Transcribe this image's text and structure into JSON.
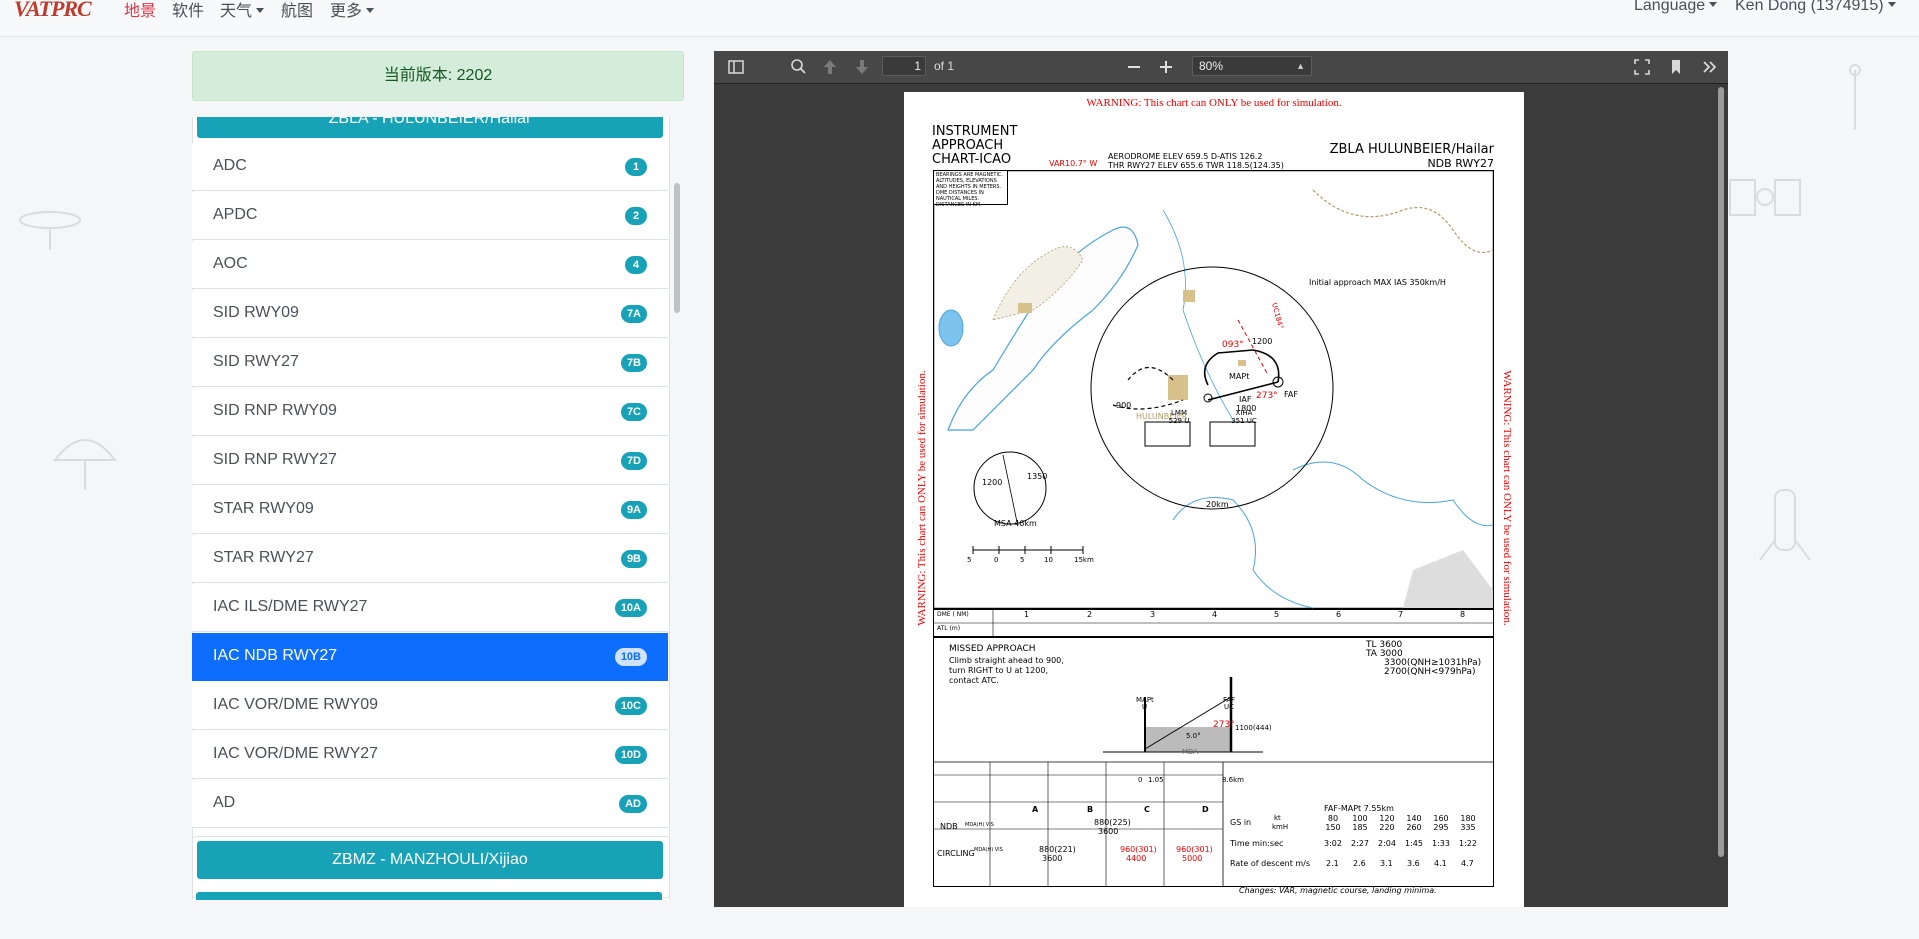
{
  "nav": {
    "brand": "VATPRC",
    "links": [
      "地景",
      "软件",
      "天气",
      "航图",
      "更多"
    ],
    "language": "Language",
    "user": "Ken Dong (1374915)"
  },
  "sidebar": {
    "version": "当前版本: 2202",
    "current_group": "ZBLA - HULUNBEIER/Hailar",
    "items": [
      {
        "label": "ADC",
        "badge": "1"
      },
      {
        "label": "APDC",
        "badge": "2"
      },
      {
        "label": "AOC",
        "badge": "4"
      },
      {
        "label": "SID RWY09",
        "badge": "7A"
      },
      {
        "label": "SID RWY27",
        "badge": "7B"
      },
      {
        "label": "SID RNP RWY09",
        "badge": "7C"
      },
      {
        "label": "SID RNP RWY27",
        "badge": "7D"
      },
      {
        "label": "STAR RWY09",
        "badge": "9A"
      },
      {
        "label": "STAR RWY27",
        "badge": "9B"
      },
      {
        "label": "IAC ILS/DME RWY27",
        "badge": "10A"
      },
      {
        "label": "IAC NDB RWY27",
        "badge": "10B"
      },
      {
        "label": "IAC VOR/DME RWY09",
        "badge": "10C"
      },
      {
        "label": "IAC VOR/DME RWY27",
        "badge": "10D"
      },
      {
        "label": "AD",
        "badge": "AD"
      }
    ],
    "next_group": "ZBMZ - MANZHOULI/Xijiao"
  },
  "viewer": {
    "page_number": "1",
    "page_of": "of 1",
    "zoom": "80%",
    "icons": [
      "sidebar-toggle-icon",
      "search-icon",
      "page-up-icon",
      "page-down-icon",
      "zoom-out-icon",
      "zoom-in-icon",
      "fullscreen-icon",
      "bookmark-icon",
      "tools-icon"
    ]
  },
  "chart": {
    "warning": "WARNING: This chart can ONLY be used for simulation.",
    "title_lines": [
      "INSTRUMENT",
      "APPROACH",
      "CHART-ICAO"
    ],
    "var": "VAR10.7° W",
    "elev": "AERODROME ELEV 659.5   D-ATIS 126.2",
    "thr": "THR RWY27 ELEV 655.6    TWR 118.5(124.35)",
    "airport": "ZBLA HULUNBEIER/Hailar",
    "procedure": "NDB RWY27",
    "bearings_note": [
      "BEARINGS ARE MAGNETIC.",
      "ALTITUDES, ELEVATIONS",
      "AND HEIGHTS IN METERS.",
      "DME DISTANCES IN",
      "NAUTICAL MILES.",
      "DISTANCES IN KM."
    ],
    "initial_approach": "Initial approach MAX IAS 350km/H",
    "city": "HULUNBEIER",
    "lmm": [
      "LMM",
      "529 U"
    ],
    "xiha": [
      "XIHA",
      "351 UC"
    ],
    "fixes": [
      "MAPt",
      "IAF",
      "FAF",
      "1800",
      "1200",
      "900"
    ],
    "courses": [
      "093°",
      "273°",
      "UC184°"
    ],
    "msa": "MSA 46km",
    "msa_alts": [
      "1200",
      "1350"
    ],
    "ring": "20km",
    "scale": [
      "5",
      "0",
      "5",
      "10",
      "15km"
    ],
    "dme_row": [
      "DME (  NM)",
      "1",
      "2",
      "3",
      "4",
      "5",
      "6",
      "7",
      "8"
    ],
    "atl_row": "ATL (m)",
    "missed_title": "MISSED APPROACH",
    "missed_text": [
      "Climb straight ahead to 900,",
      "turn RIGHT to U at 1200,",
      "contact ATC."
    ],
    "tl": [
      "TL 3600",
      "TA 3000",
      "3300(QNH≥1031hPa)",
      "2700(QNH<979hPa)"
    ],
    "profile_labels": [
      "MAPt",
      "U",
      "FAF",
      "UC",
      "273°",
      "5.0°",
      "1100(444)",
      "MDA",
      "0",
      "1.05",
      "8.6km"
    ],
    "minima_header": [
      "A",
      "B",
      "C",
      "D"
    ],
    "ndb_row": [
      "NDB",
      "MDA(H) VIS",
      "880(225)",
      "3600"
    ],
    "circling_row": [
      "CIRCLING",
      "MDA(H) VIS",
      "880(221)",
      "3600",
      "960(301)",
      "4400",
      "960(301)",
      "5000"
    ],
    "faf_table_title": "FAF-MAPt 7.55km",
    "gs_label": [
      "GS in",
      "kt",
      "kmH"
    ],
    "gs_values": [
      [
        "80",
        "150"
      ],
      [
        "100",
        "185"
      ],
      [
        "120",
        "220"
      ],
      [
        "140",
        "260"
      ],
      [
        "160",
        "295"
      ],
      [
        "180",
        "335"
      ]
    ],
    "time_label": "Time   min:sec",
    "time_values": [
      "3:02",
      "2:27",
      "2:04",
      "1:45",
      "1:33",
      "1:22"
    ],
    "descent_label": "Rate of descent m/s",
    "descent_values": [
      "2.1",
      "2.6",
      "3.1",
      "3.6",
      "4.1",
      "4.7"
    ],
    "changes": "Changes: VAR, magnetic course, landing minima."
  }
}
